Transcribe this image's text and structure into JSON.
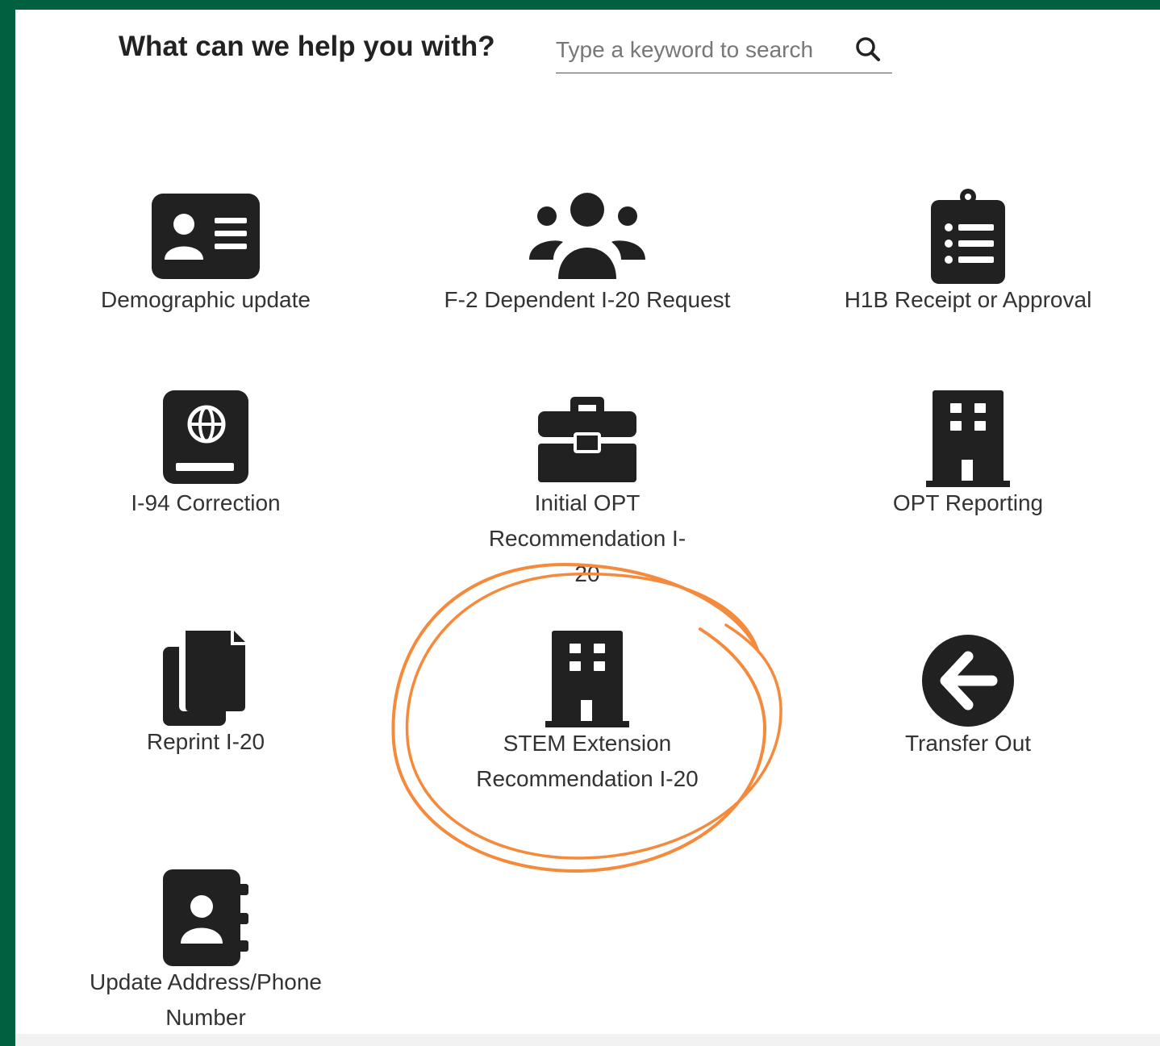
{
  "header": {
    "title": "What can we help you with?",
    "search": {
      "placeholder": "Type a keyword to search",
      "value": "",
      "icon": "search-icon"
    }
  },
  "tiles": [
    {
      "label": "Demographic update",
      "icon": "id-card-icon"
    },
    {
      "label": "F-2 Dependent I-20 Request",
      "icon": "users-icon"
    },
    {
      "label": "H1B Receipt or Approval",
      "icon": "clipboard-list-icon"
    },
    {
      "label": "I-94 Correction",
      "icon": "passport-icon"
    },
    {
      "label": "Initial OPT Recommendation I-20",
      "icon": "briefcase-icon"
    },
    {
      "label": "OPT Reporting",
      "icon": "building-icon"
    },
    {
      "label": "Reprint I-20",
      "icon": "copy-documents-icon"
    },
    {
      "label": "STEM Extension Recommendation I-20",
      "icon": "building-icon"
    },
    {
      "label": "Transfer Out",
      "icon": "arrow-left-circle-icon"
    },
    {
      "label": "Update Address/Phone Number",
      "icon": "address-book-icon"
    }
  ],
  "colors": {
    "frame": "#00603f",
    "icon": "#212121",
    "annotation": "#f58a3c"
  }
}
